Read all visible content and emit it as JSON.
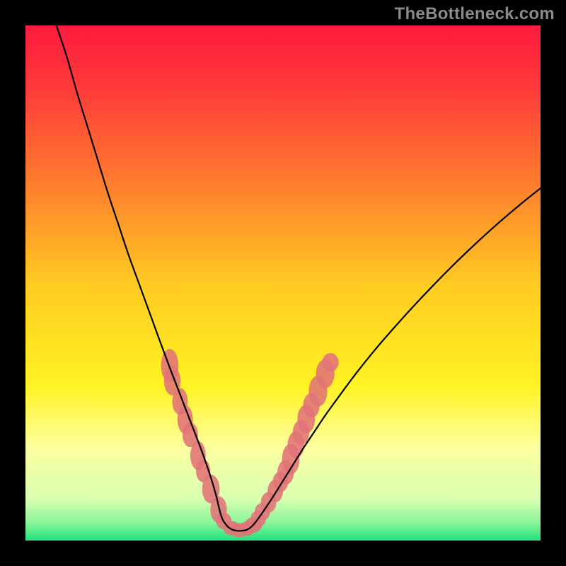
{
  "watermark": "TheBottleneck.com",
  "accent": {
    "curve_color": "#000000",
    "marker_color": "#e17377",
    "marker_color_light": "#e8a0a2",
    "green_band": "#21e37d"
  },
  "chart_data": {
    "type": "line",
    "title": "",
    "xlabel": "",
    "ylabel": "",
    "xlim": [
      0,
      100
    ],
    "ylim": [
      0,
      100
    ],
    "annotations": [
      "TheBottleneck.com"
    ],
    "gradient_stops": [
      {
        "pos": 0.0,
        "color": "#ff1a3f"
      },
      {
        "pos": 0.12,
        "color": "#ff3a3a"
      },
      {
        "pos": 0.3,
        "color": "#ff7a2e"
      },
      {
        "pos": 0.5,
        "color": "#ffca22"
      },
      {
        "pos": 0.7,
        "color": "#fff323"
      },
      {
        "pos": 0.82,
        "color": "#fdffa0"
      },
      {
        "pos": 0.92,
        "color": "#d8ffb0"
      },
      {
        "pos": 0.965,
        "color": "#8af59a"
      },
      {
        "pos": 1.0,
        "color": "#21e37d"
      }
    ],
    "series": [
      {
        "name": "left-curve",
        "x": [
          6,
          8,
          10,
          12,
          14,
          16,
          18,
          20,
          22,
          24,
          26,
          27,
          28,
          29,
          30,
          31,
          32,
          33,
          34,
          35,
          36,
          37,
          38
        ],
        "y": [
          100,
          94,
          87,
          80.5,
          74,
          67.5,
          61.5,
          55.5,
          50,
          44.5,
          39,
          36.3,
          33.6,
          31,
          28.4,
          25.8,
          23.2,
          20.6,
          18,
          15.2,
          12.2,
          8.8,
          4.8
        ]
      },
      {
        "name": "valley",
        "x": [
          38,
          39,
          40,
          41,
          42,
          43,
          44,
          45
        ],
        "y": [
          4.8,
          3.0,
          2.2,
          1.9,
          1.9,
          2.1,
          2.8,
          4.0
        ]
      },
      {
        "name": "right-curve",
        "x": [
          45,
          46,
          48,
          50,
          52,
          54,
          56,
          58,
          60,
          64,
          68,
          72,
          76,
          80,
          84,
          88,
          92,
          96,
          100
        ],
        "y": [
          4.0,
          5.4,
          8.4,
          11.6,
          14.8,
          18.0,
          21.0,
          24.0,
          26.8,
          32.2,
          37.2,
          41.8,
          46.2,
          50.4,
          54.4,
          58.2,
          61.8,
          65.2,
          68.4
        ]
      }
    ],
    "markers": [
      {
        "x": 28.0,
        "y": 34.0,
        "rx": 1.7,
        "ry": 3.2
      },
      {
        "x": 28.5,
        "y": 31.0,
        "rx": 1.6,
        "ry": 2.8
      },
      {
        "x": 30.0,
        "y": 27.0,
        "rx": 1.5,
        "ry": 2.6
      },
      {
        "x": 31.0,
        "y": 23.5,
        "rx": 1.5,
        "ry": 2.8
      },
      {
        "x": 32.0,
        "y": 20.5,
        "rx": 1.5,
        "ry": 2.4
      },
      {
        "x": 33.5,
        "y": 16.5,
        "rx": 1.5,
        "ry": 2.8
      },
      {
        "x": 34.5,
        "y": 13.5,
        "rx": 1.4,
        "ry": 2.2
      },
      {
        "x": 36.0,
        "y": 10.0,
        "rx": 1.7,
        "ry": 2.8
      },
      {
        "x": 37.5,
        "y": 6.0,
        "rx": 1.6,
        "ry": 2.6
      },
      {
        "x": 38.5,
        "y": 3.8,
        "rx": 1.5,
        "ry": 1.6
      },
      {
        "x": 40.0,
        "y": 2.4,
        "rx": 1.6,
        "ry": 1.4
      },
      {
        "x": 41.5,
        "y": 2.0,
        "rx": 1.6,
        "ry": 1.4
      },
      {
        "x": 43.0,
        "y": 2.3,
        "rx": 1.5,
        "ry": 1.4
      },
      {
        "x": 44.2,
        "y": 3.0,
        "rx": 1.7,
        "ry": 1.5
      },
      {
        "x": 45.2,
        "y": 4.2,
        "rx": 1.5,
        "ry": 1.6
      },
      {
        "x": 46.0,
        "y": 5.6,
        "rx": 1.5,
        "ry": 1.7
      },
      {
        "x": 47.2,
        "y": 7.4,
        "rx": 1.5,
        "ry": 2.0
      },
      {
        "x": 48.5,
        "y": 9.6,
        "rx": 1.5,
        "ry": 2.2
      },
      {
        "x": 49.5,
        "y": 11.4,
        "rx": 1.5,
        "ry": 2.0
      },
      {
        "x": 50.5,
        "y": 13.2,
        "rx": 1.6,
        "ry": 2.4
      },
      {
        "x": 51.5,
        "y": 15.8,
        "rx": 1.7,
        "ry": 3.0
      },
      {
        "x": 52.5,
        "y": 18.6,
        "rx": 1.6,
        "ry": 2.6
      },
      {
        "x": 53.5,
        "y": 21.0,
        "rx": 1.6,
        "ry": 2.4
      },
      {
        "x": 54.5,
        "y": 23.6,
        "rx": 1.7,
        "ry": 2.8
      },
      {
        "x": 55.5,
        "y": 26.2,
        "rx": 1.6,
        "ry": 2.4
      },
      {
        "x": 56.8,
        "y": 29.0,
        "rx": 1.8,
        "ry": 3.0
      },
      {
        "x": 58.2,
        "y": 32.4,
        "rx": 1.8,
        "ry": 2.8
      },
      {
        "x": 59.2,
        "y": 34.6,
        "rx": 1.6,
        "ry": 1.8
      }
    ]
  }
}
